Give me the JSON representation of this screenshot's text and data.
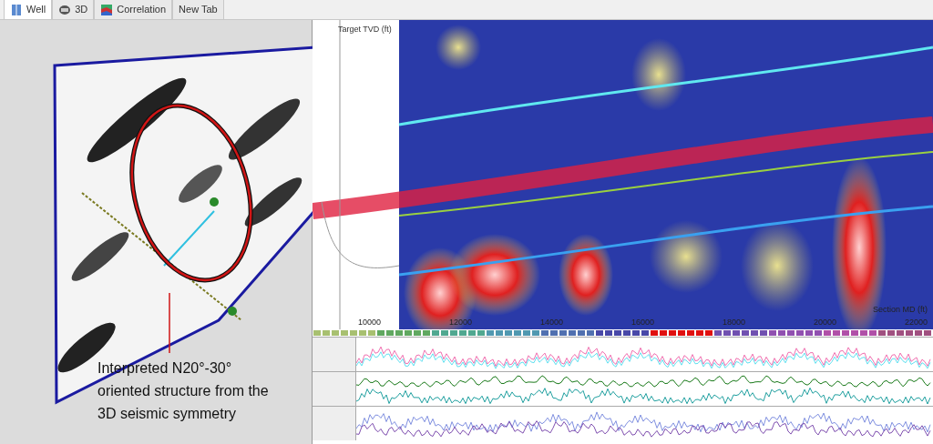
{
  "tabs": [
    {
      "label": "Well",
      "selected": true
    },
    {
      "label": "3D",
      "selected": false
    },
    {
      "label": "Correlation",
      "selected": false
    },
    {
      "label": "New Tab",
      "selected": false
    }
  ],
  "map": {
    "annotation": "Interpreted N20°-30° oriented structure from the 3D seismic symmetry"
  },
  "section": {
    "ylabel": "Target TVD (ft)",
    "xlabel": "Section MD (ft)",
    "x_ticks": [
      "10000",
      "12000",
      "14000",
      "16000",
      "18000",
      "20000",
      "22000"
    ]
  }
}
